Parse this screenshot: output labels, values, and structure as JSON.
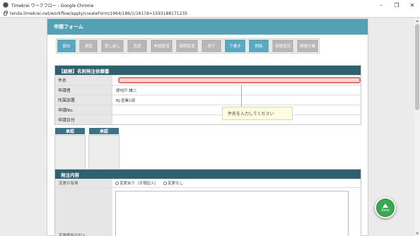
{
  "browser": {
    "window_title": "Timekrei ワークフロー - Google Chrome",
    "url": "tenda.timekrei.net/workflow/apply/createForm/1964/186/1/161?d=1593188171235",
    "controls": {
      "minimize": "–",
      "restore": "❐",
      "close": "✕"
    }
  },
  "panel": {
    "header": "申請フォーム",
    "buttons": [
      {
        "label": "提出",
        "style": "teal"
      },
      {
        "label": "承認",
        "style": "gray"
      },
      {
        "label": "差し戻し",
        "style": "gray"
      },
      {
        "label": "否認",
        "style": "gray"
      },
      {
        "label": "申請取消",
        "style": "gray"
      },
      {
        "label": "承認取消",
        "style": "gray"
      },
      {
        "label": "却下",
        "style": "gray"
      },
      {
        "label": "下書き",
        "style": "teal"
      },
      {
        "label": "削除",
        "style": "teal"
      },
      {
        "label": "承認状況",
        "style": "gray"
      },
      {
        "label": "関連文書",
        "style": "gray"
      }
    ]
  },
  "form": {
    "title": "【総務】名刺発注依頼書",
    "rows": [
      {
        "label": "件名",
        "value": ""
      },
      {
        "label": "申請者",
        "value": "様地戸 謙二"
      },
      {
        "label": "所属部署",
        "value": "BJ-営業1部"
      },
      {
        "label": "申請No.",
        "value": ""
      },
      {
        "label": "申請日付",
        "value": ""
      }
    ],
    "tooltip": "件名を入力してください"
  },
  "approvals": [
    {
      "label": "承認"
    },
    {
      "label": "承認"
    }
  ],
  "order": {
    "title": "発注内容",
    "change_label": "変更の有無",
    "option_yes": "変更あり（次項記入）",
    "option_no": "変更なし",
    "change_detail_label": "変更箇所の記入"
  },
  "fab": {
    "label": "Sero"
  },
  "colors": {
    "header": "#54a0b5",
    "dark_teal": "#2f6070",
    "button_teal": "#5aa7c0",
    "button_gray": "#b7b7b7",
    "error_input": "#fbd6d4",
    "fab_green": "#3aa851"
  }
}
